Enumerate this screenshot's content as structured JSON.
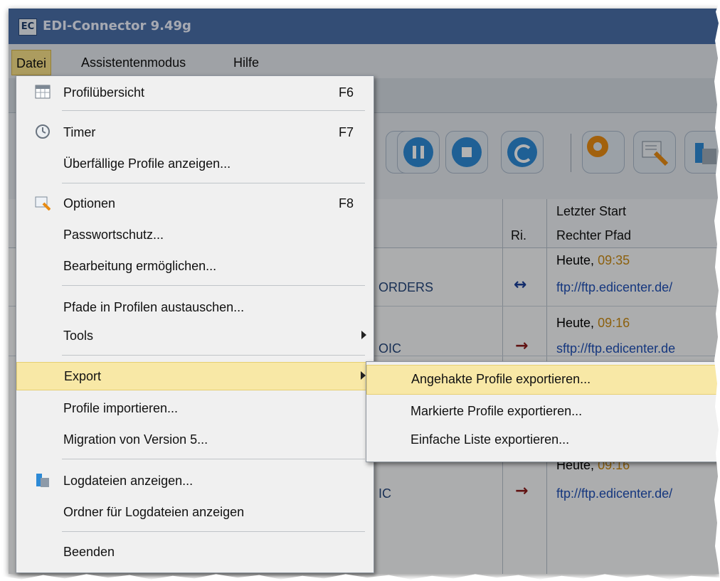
{
  "window": {
    "title": "EDI-Connector 9.49g",
    "app_icon": "EC"
  },
  "menubar": [
    {
      "label": "Datei",
      "active": true
    },
    {
      "label": "Assistentenmodus",
      "active": false
    },
    {
      "label": "Hilfe",
      "active": false
    }
  ],
  "grid": {
    "headers": {
      "last_start": "Letzter Start",
      "direction": "Ri.",
      "right_path": "Rechter Pfad"
    },
    "rows": [
      {
        "name_fragment": "ORDERS",
        "start_day": "Heute,",
        "start_time": "09:35",
        "direction": "left-right-arrow-icon",
        "path": "ftp://ftp.edicenter.de/"
      },
      {
        "name_fragment": "OIC",
        "start_day": "Heute,",
        "start_time": "09:16",
        "direction": "right-arrow-icon",
        "path": "sftp://ftp.edicenter.de"
      },
      {
        "name_fragment": "IC",
        "start_day": "Heute,",
        "start_time": "09:16",
        "direction": "right-arrow-icon",
        "path": "ftp://ftp.edicenter.de/"
      }
    ]
  },
  "file_menu": {
    "items": {
      "profile_overview": {
        "label": "Profilübersicht",
        "shortcut": "F6",
        "icon": "calendar-icon"
      },
      "timer": {
        "label": "Timer",
        "shortcut": "F7",
        "icon": "clock-icon"
      },
      "overdue_profiles": {
        "label": "Überfällige Profile anzeigen..."
      },
      "options": {
        "label": "Optionen",
        "shortcut": "F8",
        "icon": "options-icon"
      },
      "password": {
        "label": "Passwortschutz..."
      },
      "editing": {
        "label": "Bearbeitung ermöglichen..."
      },
      "replace_paths": {
        "label": "Pfade in Profilen austauschen..."
      },
      "tools": {
        "label": "Tools"
      },
      "export": {
        "label": "Export"
      },
      "import": {
        "label": "Profile importieren..."
      },
      "migration": {
        "label": "Migration von Version 5..."
      },
      "show_logs": {
        "label": "Logdateien anzeigen...",
        "icon": "log-files-icon"
      },
      "log_folder": {
        "label": "Ordner für Logdateien anzeigen"
      },
      "exit": {
        "label": "Beenden"
      }
    }
  },
  "export_submenu": {
    "items": [
      {
        "label": "Angehakte Profile exportieren...",
        "highlighted": true
      },
      {
        "label": "Markierte Profile exportieren...",
        "highlighted": false
      },
      {
        "label": "Einfache Liste exportieren...",
        "highlighted": false
      }
    ]
  },
  "colors": {
    "accent_highlight": "#f8e8a6",
    "toolbar_blue": "#2d8ad6",
    "gear_orange": "#e88b13",
    "arrow_red": "#8b1a1a",
    "arrow_blue": "#1a3f9a",
    "time_orange": "#c98a14"
  }
}
